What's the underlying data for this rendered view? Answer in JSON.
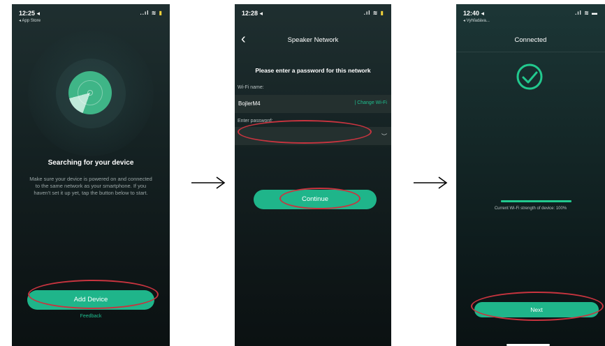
{
  "screen1": {
    "time": "12:25 ◂",
    "back_label": "◂ App Store",
    "indicators": "..ıl ≋",
    "battery": "▮",
    "title": "Searching for your device",
    "description": "Make sure your device is powered on and connected to the same network as your smartphone. If you haven't set it up yet, tap the button below to start.",
    "add_device_label": "Add Device",
    "feedback_label": "Feedback"
  },
  "screen2": {
    "time": "12:28 ◂",
    "indicators": ".ıl ≋",
    "battery": "▮",
    "nav_title": "Speaker Network",
    "back_icon": "‹",
    "prompt": "Please enter a password for this network",
    "wifi_name_label": "Wi-Fi name:",
    "wifi_name_value": "BojlerM4",
    "change_wifi_label": "| Change Wi-Fi",
    "password_label": "Enter password:",
    "password_value": "",
    "eye_icon": "︶",
    "continue_label": "Continue"
  },
  "screen3": {
    "time": "12:40 ◂",
    "back_label": "◂ Vyhľadáva...",
    "indicators": ".ıl ≋",
    "battery": "▬",
    "title": "Connected",
    "strength_text": "Current Wi-Fi strength of device: 100%",
    "strength_percent": 100,
    "next_label": "Next"
  },
  "colors": {
    "accent": "#1fb58a",
    "highlight_ellipse": "#c8343f",
    "background": "#0f1718"
  }
}
